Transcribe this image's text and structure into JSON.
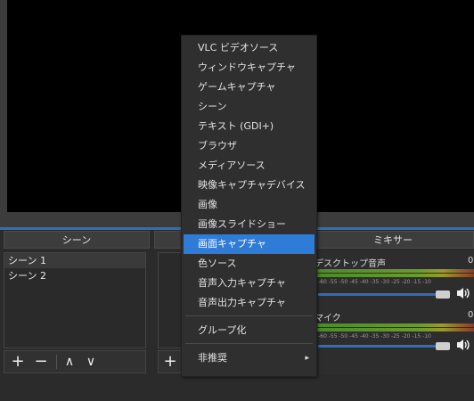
{
  "scenes": {
    "header": "シーン",
    "items": [
      "シーン 1",
      "シーン 2"
    ],
    "toolbar": {
      "add": "+",
      "remove": "−",
      "up": "∧",
      "down": "∨"
    }
  },
  "sources": {
    "toolbar": {
      "add": "+"
    }
  },
  "mixer": {
    "header": "ミキサー",
    "channels": [
      {
        "label": "デスクトップ音声",
        "value": "0",
        "volume": 0.95
      },
      {
        "label": "マイク",
        "value": "0",
        "volume": 0.95
      }
    ],
    "ticks": "-60 -55 -50 -45 -40 -35 -30 -25 -20 -15 -10"
  },
  "context_menu": {
    "items": [
      "VLC ビデオソース",
      "ウィンドウキャプチャ",
      "ゲームキャプチャ",
      "シーン",
      "テキスト (GDI+)",
      "ブラウザ",
      "メディアソース",
      "映像キャプチャデバイス",
      "画像",
      "画像スライドショー",
      "画面キャプチャ",
      "色ソース",
      "音声入力キャプチャ",
      "音声出力キャプチャ"
    ],
    "highlighted_index": 10,
    "group_label": "グループ化",
    "deprecated_label": "非推奨",
    "submenu_arrow": "▸"
  },
  "colors": {
    "highlight": "#2f7bd8",
    "slider": "#2f6dbf"
  }
}
